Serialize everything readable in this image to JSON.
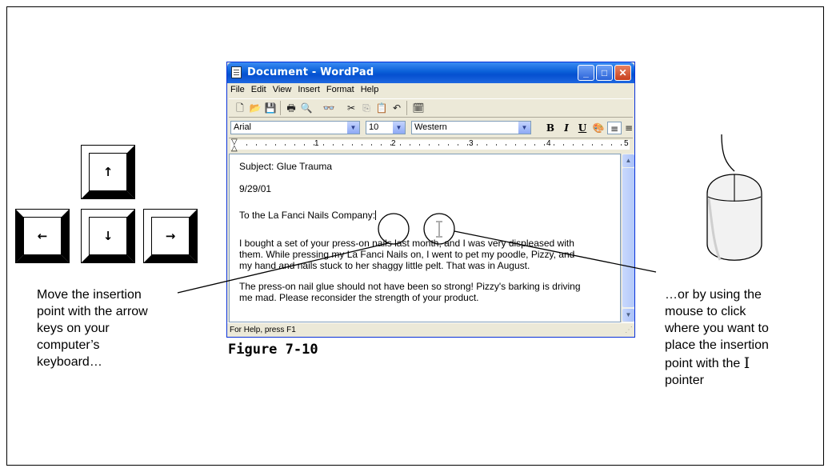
{
  "keys": {
    "up": "↑",
    "left": "←",
    "down": "↓",
    "right": "→"
  },
  "window": {
    "title": "Document - WordPad",
    "buttons": {
      "minimize": "_",
      "maximize": "□",
      "close": "✕"
    },
    "menu": [
      "File",
      "Edit",
      "View",
      "Insert",
      "Format",
      "Help"
    ],
    "toolbar_icons": [
      "new-icon",
      "open-icon",
      "save-icon",
      "print-icon",
      "print-preview-icon",
      "find-icon",
      "cut-icon",
      "copy-icon",
      "paste-icon",
      "undo-icon",
      "date-time-icon"
    ],
    "format": {
      "font": "Arial",
      "size": "10",
      "script": "Western",
      "bold": "B",
      "italic": "I",
      "underline": "U"
    },
    "ruler_numbers": [
      "1",
      "2",
      "3",
      "4",
      "5"
    ],
    "document_lines": {
      "subject": "Subject: Glue Trauma",
      "date": "9/29/01",
      "to": "To the La Fanci Nails Company:",
      "p1_l1": "I bought a set of your press-on nails last month, and I was very displeased with",
      "p1_l2": "them. While pressing my La Fanci Nails on, I went to pet my poodle, Pizzy, and",
      "p1_l3": "my hand and nails stuck to her shaggy little pelt. That was in August.",
      "p2_l1": "The press-on nail glue should not have been so strong! Pizzy's barking is driving",
      "p2_l2": "me mad. Please reconsider the strength of your product."
    },
    "status": "For Help, press F1"
  },
  "figure_label": "Figure 7-10",
  "caption_left": {
    "l1": "Move the insertion",
    "l2": "point with the arrow",
    "l3": "keys on your",
    "l4": "computer’s",
    "l5": "keyboard…"
  },
  "caption_right": {
    "l1": "…or by using the",
    "l2": "mouse to click",
    "l3": "where you want to",
    "l4": "place the insertion",
    "l5": "point with the",
    "l5_icon": "I",
    "l6": "pointer"
  }
}
